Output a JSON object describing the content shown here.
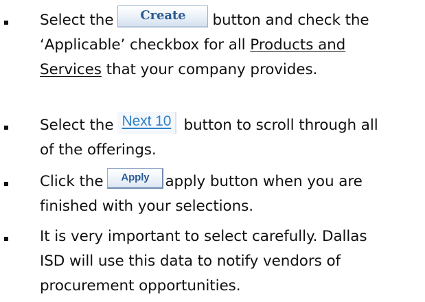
{
  "steps": [
    {
      "line1_a": "Select the",
      "button": "Create",
      "line1_b": "button and check the",
      "line2": "‘Applicable’ checkbox for all",
      "link_a": "Products and",
      "link_b": "Services",
      "line3_rest": " that your company provides."
    },
    {
      "line1_a": "Select the",
      "button": "Next 10",
      "line1_b": "button to scroll through all",
      "line2": "of the offerings."
    },
    {
      "line1_a": "Click the",
      "button": "Apply",
      "line1_b": "apply button when you are",
      "line2": "finished with your selections."
    },
    {
      "line1": "It is very important to select carefully.  Dallas",
      "line2": "ISD will use this data to notify vendors of",
      "line3": "procurement opportunities."
    }
  ]
}
